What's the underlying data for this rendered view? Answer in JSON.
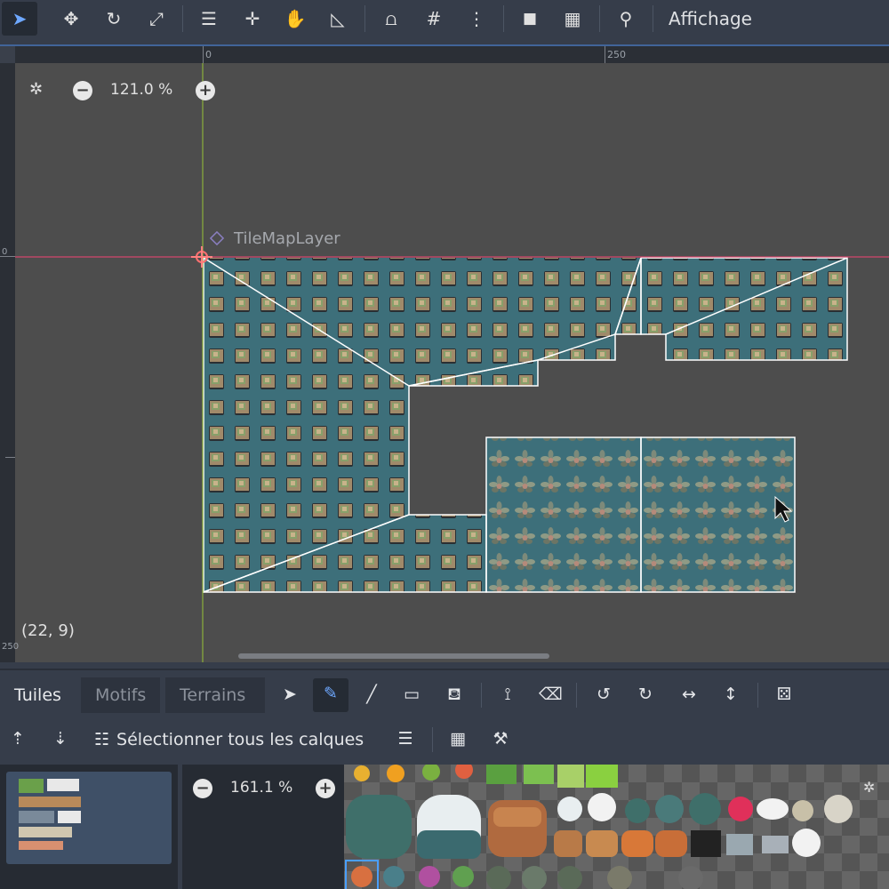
{
  "toolbar": {
    "tools": [
      {
        "name": "select-icon",
        "glyph": "➤"
      },
      {
        "name": "move-icon",
        "glyph": "✥"
      },
      {
        "name": "rotate-icon",
        "glyph": "↻"
      },
      {
        "name": "scale-icon",
        "glyph": "⤢"
      },
      {
        "name": "list-select-icon",
        "glyph": "☰"
      },
      {
        "name": "pivot-icon",
        "glyph": "✛"
      },
      {
        "name": "pan-icon",
        "glyph": "✋"
      },
      {
        "name": "ruler-icon",
        "glyph": "◺"
      },
      {
        "name": "smart-snap-icon",
        "glyph": "⩍"
      },
      {
        "name": "grid-snap-icon",
        "glyph": "#"
      },
      {
        "name": "more-options-icon",
        "glyph": "⋮"
      },
      {
        "name": "lock-icon",
        "glyph": "🔒"
      },
      {
        "name": "group-icon",
        "glyph": "▦"
      },
      {
        "name": "bone-icon",
        "glyph": "⚲"
      }
    ],
    "view_menu": "Affichage"
  },
  "viewport": {
    "zoom_text": "121.0 %",
    "node_label": "TileMapLayer",
    "coords": "(22, 9)",
    "ruler_top_labels": [
      "0",
      "250"
    ],
    "ruler_left_labels": [
      "0",
      "250"
    ]
  },
  "bottom": {
    "tabs": [
      "Tuiles",
      "Motifs",
      "Terrains"
    ],
    "select_all_layers": "Sélectionner tous les calques",
    "atlas_zoom": "161.1 %"
  },
  "colors": {
    "tile_bg": "#3d6f7a",
    "tile_block": "#a08a6a",
    "outline": "#ffffff",
    "axis_x": "#d1456b",
    "axis_y": "#8bb03a",
    "accent": "#4a7fcf"
  }
}
